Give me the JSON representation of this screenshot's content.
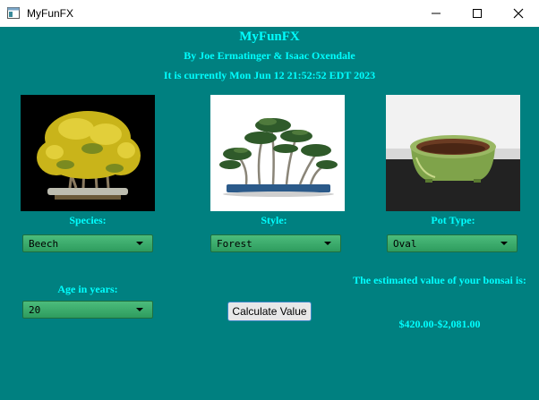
{
  "window": {
    "title": "MyFunFX"
  },
  "header": {
    "title": "MyFunFX",
    "authors": "By Joe Ermatinger & Isaac Oxendale",
    "timestamp": "It is currently Mon Jun 12 21:52:52 EDT 2023"
  },
  "species": {
    "label": "Species:",
    "value": "Beech"
  },
  "style": {
    "label": "Style:",
    "value": "Forest"
  },
  "pot": {
    "label": "Pot Type:",
    "value": "Oval"
  },
  "age": {
    "label": "Age in years:",
    "value": "20"
  },
  "calculate_label": "Calculate Value",
  "estimate": {
    "label": "The estimated value of your bonsai is:",
    "value": "$420.00-$2,081.00"
  },
  "colors": {
    "background": "#008080",
    "text": "#00ffff",
    "combo": "#3cae6e"
  }
}
